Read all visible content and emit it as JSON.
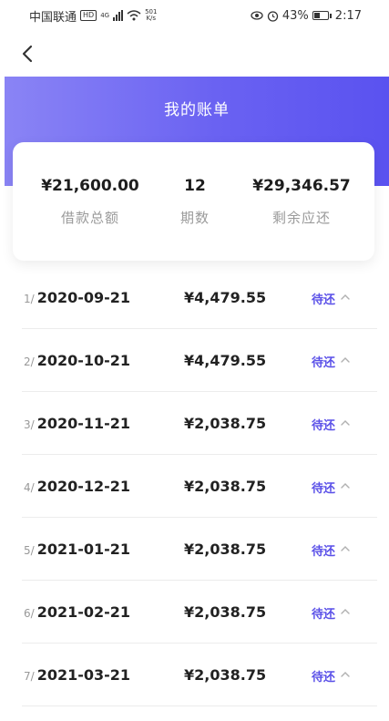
{
  "status_bar": {
    "carrier": "中国联通",
    "hd_badge": "HD",
    "net_type": "4G",
    "speed_value": "501",
    "speed_unit": "K/s",
    "battery": "43%",
    "battery_level": 0.43,
    "time": "2:17"
  },
  "header": {
    "title": "我的账单"
  },
  "summary": {
    "total_amount": "¥21,600.00",
    "total_label": "借款总额",
    "periods": "12",
    "periods_label": "期数",
    "remaining": "¥29,346.57",
    "remaining_label": "剩余应还"
  },
  "bills": [
    {
      "index": "1/",
      "date": "2020-09-21",
      "amount": "¥4,479.55",
      "status": "待还"
    },
    {
      "index": "2/",
      "date": "2020-10-21",
      "amount": "¥4,479.55",
      "status": "待还"
    },
    {
      "index": "3/",
      "date": "2020-11-21",
      "amount": "¥2,038.75",
      "status": "待还"
    },
    {
      "index": "4/",
      "date": "2020-12-21",
      "amount": "¥2,038.75",
      "status": "待还"
    },
    {
      "index": "5/",
      "date": "2021-01-21",
      "amount": "¥2,038.75",
      "status": "待还"
    },
    {
      "index": "6/",
      "date": "2021-02-21",
      "amount": "¥2,038.75",
      "status": "待还"
    },
    {
      "index": "7/",
      "date": "2021-03-21",
      "amount": "¥2,038.75",
      "status": "待还"
    }
  ],
  "colors": {
    "accent": "#5a50e8",
    "header_gradient_start": "#8a84f5",
    "header_gradient_end": "#5a52f0"
  }
}
